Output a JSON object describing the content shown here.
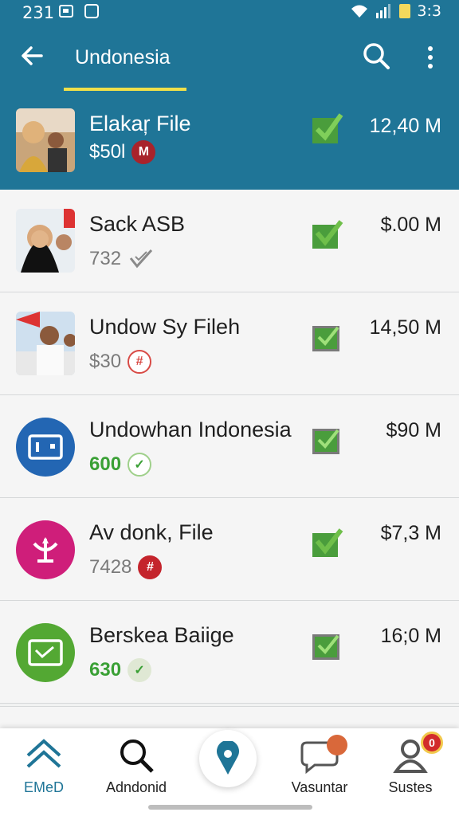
{
  "status_bar": {
    "time": "231",
    "clock": "3:3"
  },
  "app_bar": {
    "title": "Undonesia"
  },
  "rows": [
    {
      "name": "Elakaŗ File",
      "sub": "$50l",
      "size": "12,40 M",
      "badge_color": "#a8232b",
      "badge_text": "M",
      "sub_style": "normal"
    },
    {
      "name": "Sack ASB",
      "sub": "732",
      "size": "$.00 M",
      "badge_color": "#9e9e9e",
      "badge_text": "✓",
      "sub_style": "normal"
    },
    {
      "name": "Undow Sy Fileh",
      "sub": "$30",
      "size": "14,50 M",
      "badge_color": "#d84a45",
      "badge_text": "#",
      "sub_style": "normal"
    },
    {
      "name": "Undowhan Indonesia",
      "sub": "600",
      "size": "$90 M",
      "badge_color": "#3aa035",
      "badge_text": "✓",
      "sub_style": "green"
    },
    {
      "name": "Av donk, File",
      "sub": "7428",
      "size": "$7,3 M",
      "badge_color": "#c4242c",
      "badge_text": "#",
      "sub_style": "normal"
    },
    {
      "name": "Berskea Baiige",
      "sub": "630",
      "size": "16;0 M",
      "badge_color": "#8cbf5a",
      "badge_text": "✓",
      "sub_style": "green"
    }
  ],
  "bottom_nav": {
    "items": [
      {
        "label": "EMeD"
      },
      {
        "label": "Adndonid"
      },
      {
        "label": "Vasuntar"
      },
      {
        "label": "Sustes"
      }
    ],
    "notification_count": "0"
  },
  "colors": {
    "primary": "#1f7597",
    "accent": "#f0e04a",
    "check": "#4a9d3c"
  },
  "icons": [
    "back-arrow-icon",
    "search-icon",
    "more-vert-icon",
    "check-icon",
    "chevron-up-icon",
    "location-pin-icon",
    "chat-bubble-icon",
    "person-icon"
  ]
}
